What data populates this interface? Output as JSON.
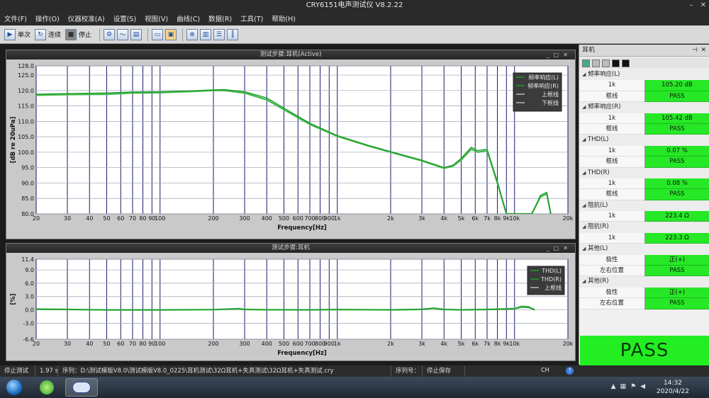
{
  "window": {
    "title": "CRY6151电声测试仪 V8.2.22"
  },
  "menu": [
    "文件(F)",
    "操作(O)",
    "仪器校准(A)",
    "设置(S)",
    "视图(V)",
    "曲线(C)",
    "数据(R)",
    "工具(T)",
    "帮助(H)"
  ],
  "toolbar": {
    "single": "单次",
    "continuous": "连续",
    "stop": "停止"
  },
  "panel_top": {
    "title": "测试步骤:耳机(Active)"
  },
  "panel_bottom": {
    "title": "测试步骤:耳机"
  },
  "right_panel": {
    "title": "耳机",
    "groups": [
      {
        "name": "频率响应(L)",
        "rows": [
          {
            "k": "1k",
            "v": "105.20 dB"
          },
          {
            "k": "框线",
            "v": "PASS"
          }
        ]
      },
      {
        "name": "频率响应(R)",
        "rows": [
          {
            "k": "1k",
            "v": "105.42 dB"
          },
          {
            "k": "框线",
            "v": "PASS"
          }
        ]
      },
      {
        "name": "THD(L)",
        "rows": [
          {
            "k": "1k",
            "v": "0.07 %"
          },
          {
            "k": "框线",
            "v": "PASS"
          }
        ]
      },
      {
        "name": "THD(R)",
        "rows": [
          {
            "k": "1k",
            "v": "0.08 %"
          },
          {
            "k": "框线",
            "v": "PASS"
          }
        ]
      },
      {
        "name": "阻抗(L)",
        "rows": [
          {
            "k": "1k",
            "v": "223.4 Ω"
          }
        ]
      },
      {
        "name": "阻抗(R)",
        "rows": [
          {
            "k": "1k",
            "v": "223.3 Ω"
          }
        ]
      },
      {
        "name": "其他(L)",
        "rows": [
          {
            "k": "极性",
            "v": "正(+)"
          },
          {
            "k": "左右位置",
            "v": "PASS"
          }
        ]
      },
      {
        "name": "其他(R)",
        "rows": [
          {
            "k": "极性",
            "v": "正(+)"
          },
          {
            "k": "左右位置",
            "v": "PASS"
          }
        ]
      }
    ],
    "result": "PASS"
  },
  "status": {
    "state": "停止测试",
    "time": "1.97 s",
    "sequence": "序列：D:\\测试模版V8.0\\测试模版V8.0_0225\\耳机测试\\32Ω耳机+失真测试\\32Ω耳机+失真测试.cry",
    "serial_label": "序列号：",
    "save": "停止保存"
  },
  "taskbar": {
    "time": "14:32",
    "date": "2020/4/22",
    "ime": "CH"
  },
  "colors": {
    "curve": "#1a9c2a",
    "curve2": "#43b84a",
    "pass": "#22ee22",
    "grid_major": "#1a1a6a",
    "grid_minor": "#9aa0b4"
  },
  "chart_data": [
    {
      "type": "line",
      "title": "",
      "xlabel": "Frequency[Hz]",
      "ylabel": "[dB re 20uPa]",
      "xscale": "log",
      "xlim": [
        20,
        20000
      ],
      "ylim": [
        80,
        128
      ],
      "xticks": [
        20,
        30,
        40,
        50,
        60,
        70,
        80,
        90,
        100,
        200,
        300,
        400,
        500,
        600,
        700,
        800,
        900,
        1000,
        2000,
        3000,
        4000,
        5000,
        6000,
        7000,
        8000,
        9000,
        10000,
        20000
      ],
      "xtick_labels": [
        "20",
        "30",
        "40",
        "50",
        "60",
        "70",
        "80",
        "90",
        "100",
        "200",
        "300",
        "400",
        "500",
        "600",
        "700",
        "800",
        "900",
        "1k",
        "2k",
        "3k",
        "4k",
        "5k",
        "6k",
        "7k",
        "8k",
        "9k",
        "10k",
        "20k"
      ],
      "yticks": [
        80.0,
        85.0,
        90.0,
        95.0,
        100.0,
        105.0,
        110.0,
        115.0,
        120.0,
        125.0,
        128.0
      ],
      "ytick_labels": [
        "80.0",
        "85.0",
        "90.0",
        "95.0",
        "100.0",
        "105.0",
        "110.0",
        "115.0",
        "120.0",
        "125.0",
        "128.0"
      ],
      "legend": [
        "频率响应(L)",
        "频率响应(R)",
        "上框线",
        "下框线"
      ],
      "legend_position": "top-right",
      "series": [
        {
          "name": "频率响应(L)",
          "x": [
            20,
            30,
            50,
            70,
            100,
            150,
            200,
            230,
            300,
            400,
            500,
            700,
            1000,
            1500,
            2000,
            3000,
            4000,
            4500,
            5000,
            5700,
            6200,
            7000,
            8000,
            9000,
            12500,
            14000,
            15200,
            16000
          ],
          "y": [
            118.5,
            118.7,
            118.8,
            119.2,
            119.3,
            119.7,
            120.0,
            120.0,
            119.2,
            117.0,
            113.8,
            109.0,
            105.2,
            102.0,
            100.0,
            97.2,
            94.8,
            95.5,
            97.5,
            101.0,
            100.0,
            100.5,
            90.0,
            80.0,
            80.0,
            85.5,
            86.5,
            80.0
          ]
        },
        {
          "name": "频率响应(R)",
          "x": [
            20,
            30,
            50,
            70,
            100,
            150,
            200,
            230,
            300,
            400,
            500,
            700,
            1000,
            1500,
            2000,
            3000,
            4000,
            4500,
            5000,
            5700,
            6200,
            7000,
            8000,
            9000,
            12500,
            14000,
            15200,
            16000
          ],
          "y": [
            118.8,
            119.0,
            119.2,
            119.5,
            119.6,
            119.9,
            120.2,
            120.3,
            119.6,
            117.6,
            114.3,
            109.4,
            105.4,
            102.2,
            100.2,
            97.4,
            95.0,
            95.8,
            98.0,
            101.6,
            100.5,
            101.0,
            90.5,
            80.0,
            80.0,
            86.0,
            87.0,
            80.0
          ]
        }
      ]
    },
    {
      "type": "line",
      "title": "",
      "xlabel": "Frequency[Hz]",
      "ylabel": "[%]",
      "xscale": "log",
      "xlim": [
        20,
        20000
      ],
      "ylim": [
        -6.6,
        11.4
      ],
      "xticks": [
        20,
        30,
        40,
        50,
        60,
        70,
        80,
        90,
        100,
        200,
        300,
        400,
        500,
        600,
        700,
        800,
        900,
        1000,
        2000,
        3000,
        4000,
        5000,
        6000,
        7000,
        8000,
        9000,
        10000,
        20000
      ],
      "xtick_labels": [
        "20",
        "30",
        "40",
        "50",
        "60",
        "70",
        "80",
        "90",
        "100",
        "200",
        "300",
        "400",
        "500",
        "600",
        "700",
        "800",
        "900",
        "1k",
        "2k",
        "3k",
        "4k",
        "5k",
        "6k",
        "7k",
        "8k",
        "9k",
        "10k",
        "20k"
      ],
      "yticks": [
        -6.6,
        -3.0,
        0.0,
        3.0,
        6.0,
        9.0,
        11.4
      ],
      "ytick_labels": [
        "-6.6",
        "-3.0",
        "0.0",
        "3.0",
        "6.0",
        "9.0",
        "11.4"
      ],
      "legend": [
        "THD(L)",
        "THD(R)",
        "上框线"
      ],
      "legend_position": "top-right",
      "series": [
        {
          "name": "THD(L)",
          "x": [
            20,
            30,
            50,
            100,
            200,
            280,
            300,
            400,
            700,
            1000,
            2000,
            3000,
            3500,
            4000,
            5000,
            7000,
            10000,
            11000,
            12000,
            13000
          ],
          "y": [
            0.2,
            0.1,
            0.0,
            0.0,
            0.05,
            0.3,
            0.1,
            0.05,
            0.0,
            0.07,
            0.0,
            0.1,
            0.4,
            0.1,
            0.0,
            0.1,
            0.3,
            0.8,
            0.7,
            0.0
          ]
        },
        {
          "name": "THD(R)",
          "x": [
            20,
            30,
            50,
            100,
            200,
            280,
            300,
            400,
            700,
            1000,
            2000,
            3000,
            3500,
            4000,
            5000,
            7000,
            10000,
            11000,
            12000,
            13000
          ],
          "y": [
            0.1,
            0.05,
            0.0,
            0.0,
            0.1,
            0.2,
            0.05,
            0.0,
            0.05,
            0.08,
            0.05,
            0.15,
            0.3,
            0.05,
            0.05,
            0.05,
            0.2,
            0.6,
            0.5,
            0.05
          ]
        }
      ]
    }
  ]
}
